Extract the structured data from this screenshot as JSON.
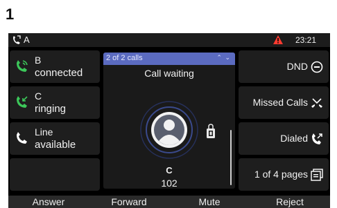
{
  "figure_number": "1",
  "status_bar": {
    "line_label": "A",
    "time": "23:21"
  },
  "left_buttons": [
    {
      "line1": "B",
      "line2": "connected",
      "icon": "call-connected-icon",
      "icon_color": "#3cc85a"
    },
    {
      "line1": "C",
      "line2": "ringing",
      "icon": "incoming-call-icon",
      "icon_color": "#3cc85a"
    },
    {
      "line1": "Line",
      "line2": "available",
      "icon": "phone-handset-icon",
      "icon_color": "#ffffff"
    },
    {
      "line1": "",
      "line2": "",
      "icon": "",
      "icon_color": ""
    }
  ],
  "call_panel": {
    "count": "2 of 2 calls",
    "status": "Call waiting",
    "caller_name": "C",
    "caller_number": "102",
    "header_color": "#5b6bc0"
  },
  "right_buttons": [
    {
      "label": "DND",
      "icon": "minus-circle-icon"
    },
    {
      "label": "Missed Calls",
      "icon": "missed-calls-icon"
    },
    {
      "label": "Dialed",
      "icon": "dialed-call-icon"
    },
    {
      "label": "1 of 4 pages",
      "icon": "pages-icon"
    }
  ],
  "softkeys": [
    "Answer",
    "Forward",
    "Mute",
    "Reject"
  ],
  "alert_color": "#ff3b30"
}
